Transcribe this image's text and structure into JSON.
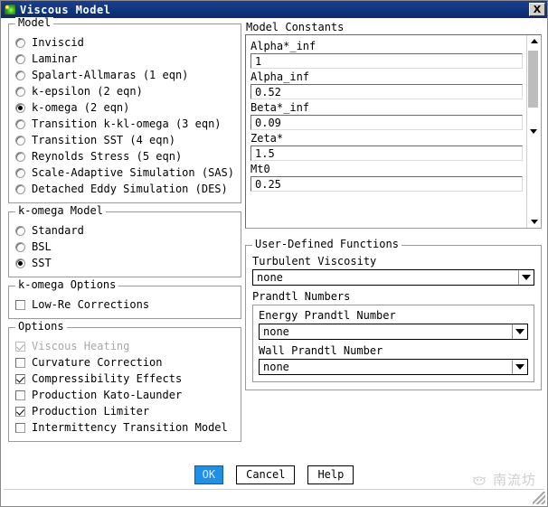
{
  "window": {
    "title": "Viscous Model",
    "icon": "fluent-app-icon",
    "close_label": "X"
  },
  "model_group": {
    "title": "Model",
    "selected": "k-omega (2 eqn)",
    "items": [
      {
        "label": "Inviscid",
        "checked": false
      },
      {
        "label": "Laminar",
        "checked": false
      },
      {
        "label": "Spalart-Allmaras (1 eqn)",
        "checked": false
      },
      {
        "label": "k-epsilon (2 eqn)",
        "checked": false
      },
      {
        "label": "k-omega (2 eqn)",
        "checked": true
      },
      {
        "label": "Transition k-kl-omega (3 eqn)",
        "checked": false
      },
      {
        "label": "Transition SST (4 eqn)",
        "checked": false
      },
      {
        "label": "Reynolds Stress (5 eqn)",
        "checked": false
      },
      {
        "label": "Scale-Adaptive Simulation (SAS)",
        "checked": false
      },
      {
        "label": "Detached Eddy Simulation (DES)",
        "checked": false
      }
    ]
  },
  "komega_model_group": {
    "title": "k-omega Model",
    "selected": "SST",
    "items": [
      {
        "label": "Standard",
        "checked": false
      },
      {
        "label": "BSL",
        "checked": false
      },
      {
        "label": "SST",
        "checked": true
      }
    ]
  },
  "komega_options_group": {
    "title": "k-omega Options",
    "items": [
      {
        "label": "Low-Re Corrections",
        "checked": false,
        "disabled": false
      }
    ]
  },
  "options_group": {
    "title": "Options",
    "items": [
      {
        "label": "Viscous Heating",
        "checked": true,
        "disabled": true
      },
      {
        "label": "Curvature Correction",
        "checked": false,
        "disabled": false
      },
      {
        "label": "Compressibility Effects",
        "checked": true,
        "disabled": false
      },
      {
        "label": "Production Kato-Launder",
        "checked": false,
        "disabled": false
      },
      {
        "label": "Production Limiter",
        "checked": true,
        "disabled": false
      },
      {
        "label": "Intermittency Transition Model",
        "checked": false,
        "disabled": false
      }
    ]
  },
  "model_constants": {
    "title": "Model Constants",
    "entries": [
      {
        "label": "Alpha*_inf",
        "value": "1"
      },
      {
        "label": "Alpha_inf",
        "value": "0.52"
      },
      {
        "label": "Beta*_inf",
        "value": "0.09"
      },
      {
        "label": "Zeta*",
        "value": "1.5"
      },
      {
        "label": "Mt0",
        "value": "0.25"
      }
    ],
    "scroll_up_icon": "triangle-up-icon",
    "scroll_down_icon": "triangle-down-icon"
  },
  "udf_group": {
    "title": "User-Defined Functions",
    "turbulent_viscosity": {
      "label": "Turbulent Viscosity",
      "value": "none"
    },
    "prandtl_numbers": {
      "title": "Prandtl Numbers",
      "energy": {
        "label": "Energy Prandtl Number",
        "value": "none"
      },
      "wall": {
        "label": "Wall Prandtl Number",
        "value": "none"
      }
    }
  },
  "buttons": {
    "ok": "OK",
    "cancel": "Cancel",
    "help": "Help"
  },
  "watermark": {
    "text": "南流坊"
  },
  "colors": {
    "titlebar": "#12357f",
    "primary_button": "#1e90e8",
    "group_border": "#9b9b9b"
  }
}
